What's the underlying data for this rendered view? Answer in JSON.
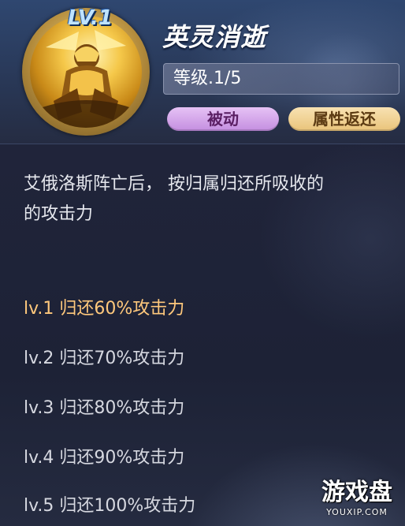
{
  "skill": {
    "level_badge": "LV.1",
    "name": "英灵消逝",
    "grade": "等级.1/5",
    "tags": [
      "被动",
      "属性返还"
    ]
  },
  "description": {
    "line1": "艾俄洛斯阵亡后， 按归属归还所吸收的",
    "line2": "的攻击力"
  },
  "levels": [
    {
      "label": "lv.1 归还60%攻击力",
      "active": true
    },
    {
      "label": "lv.2 归还70%攻击力",
      "active": false
    },
    {
      "label": "lv.3 归还80%攻击力",
      "active": false
    },
    {
      "label": "lv.4 归还90%攻击力",
      "active": false
    },
    {
      "label": "lv.5 归还100%攻击力",
      "active": false
    }
  ],
  "watermark": {
    "title": "游戏盘",
    "url": "YOUXIP.COM"
  },
  "colors": {
    "active_level": "#ffc87c",
    "passive_tag": "#c48ee0",
    "return_tag": "#e9c37a"
  }
}
